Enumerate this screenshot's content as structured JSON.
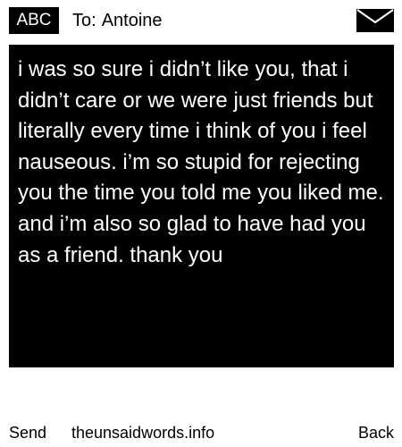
{
  "header": {
    "mode_badge": "ABC",
    "to_prefix": "To:",
    "recipient": "Antoine",
    "icons": {
      "compose": "mail-envelope-icon"
    }
  },
  "message": {
    "body": "i was so sure i didn’t like you, that i didn’t care or we were just friends but literally every time i think of you i feel nauseous. i’m so stupid for rejecting you the time you told me you liked me. and i’m also so glad to have had you as a friend. thank you"
  },
  "footer": {
    "left_softkey": "Send",
    "site": "theunsaidwords.info",
    "right_softkey": "Back"
  },
  "colors": {
    "background": "#ffffff",
    "message_box": "#000000",
    "message_text": "#ffffff",
    "foreground": "#000000"
  }
}
